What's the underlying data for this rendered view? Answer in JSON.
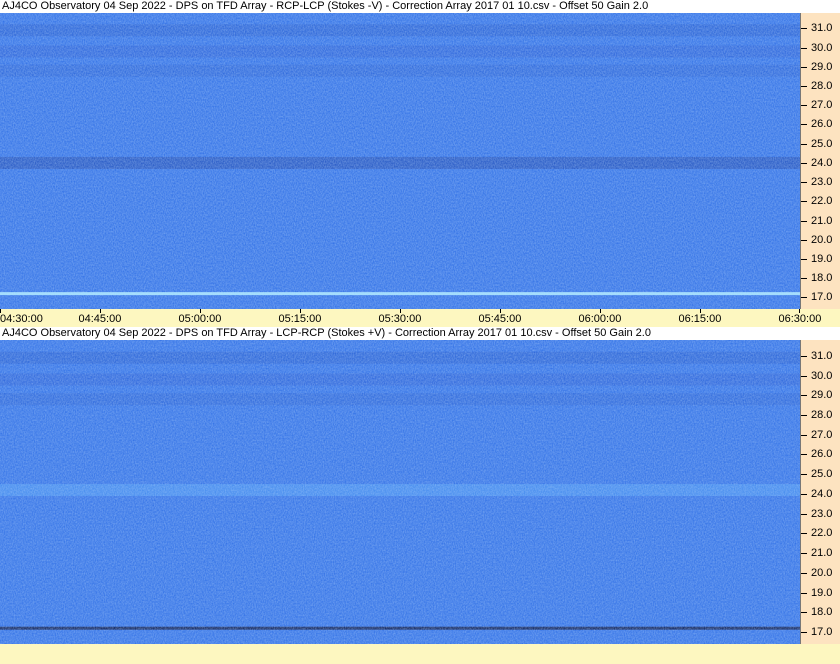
{
  "chart_data": [
    {
      "type": "heatmap",
      "title": "AJ4CO Observatory 04 Sep 2022  -  DPS on TFD Array  -  RCP-LCP (Stokes -V)  -  Correction Array 2017 01 10.csv  -  Offset 50  Gain 2.0",
      "y_ticks": [
        "31.0",
        "30.0",
        "29.0",
        "28.0",
        "27.0",
        "26.0",
        "25.0",
        "24.0",
        "23.0",
        "22.0",
        "21.0",
        "20.0",
        "19.0",
        "18.0",
        "17.0"
      ],
      "x_ticks": [
        "04:30:00",
        "04:45:00",
        "05:00:00",
        "05:15:00",
        "05:30:00",
        "05:45:00",
        "06:00:00",
        "06:15:00",
        "06:30:00"
      ],
      "xlim": [
        "04:30:00",
        "06:30:00"
      ],
      "ylim": [
        16.4,
        31.8
      ],
      "base_color": "#2f6fe6",
      "bands": [
        {
          "freq": 30.9,
          "color": "#1f52c8",
          "opacity": 0.45
        },
        {
          "freq": 29.8,
          "color": "#2456cc",
          "opacity": 0.4
        },
        {
          "freq": 28.8,
          "color": "#2355c8",
          "opacity": 0.35
        },
        {
          "freq": 24.0,
          "color": "#173fa8",
          "opacity": 0.55
        },
        {
          "freq": 17.2,
          "color": "#a8e8ff",
          "opacity": 0.9
        }
      ]
    },
    {
      "type": "heatmap",
      "title": "AJ4CO Observatory 04 Sep 2022  -  DPS on TFD Array  -  LCP-RCP (Stokes +V)  -  Correction Array 2017 01 10.csv  -  Offset 50  Gain 2.0",
      "y_ticks": [
        "31.0",
        "30.0",
        "29.0",
        "28.0",
        "27.0",
        "26.0",
        "25.0",
        "24.0",
        "23.0",
        "22.0",
        "21.0",
        "20.0",
        "19.0",
        "18.0",
        "17.0"
      ],
      "xlim": [
        "04:30:00",
        "06:30:00"
      ],
      "ylim": [
        16.4,
        31.8
      ],
      "base_color": "#2f6fe6",
      "bands": [
        {
          "freq": 30.9,
          "color": "#1f52c8",
          "opacity": 0.45
        },
        {
          "freq": 29.8,
          "color": "#2456cc",
          "opacity": 0.4
        },
        {
          "freq": 28.8,
          "color": "#2355c8",
          "opacity": 0.35
        },
        {
          "freq": 24.2,
          "color": "#4f9cf4",
          "opacity": 0.55
        },
        {
          "freq": 17.2,
          "color": "#0a1a50",
          "opacity": 0.9
        }
      ]
    }
  ]
}
